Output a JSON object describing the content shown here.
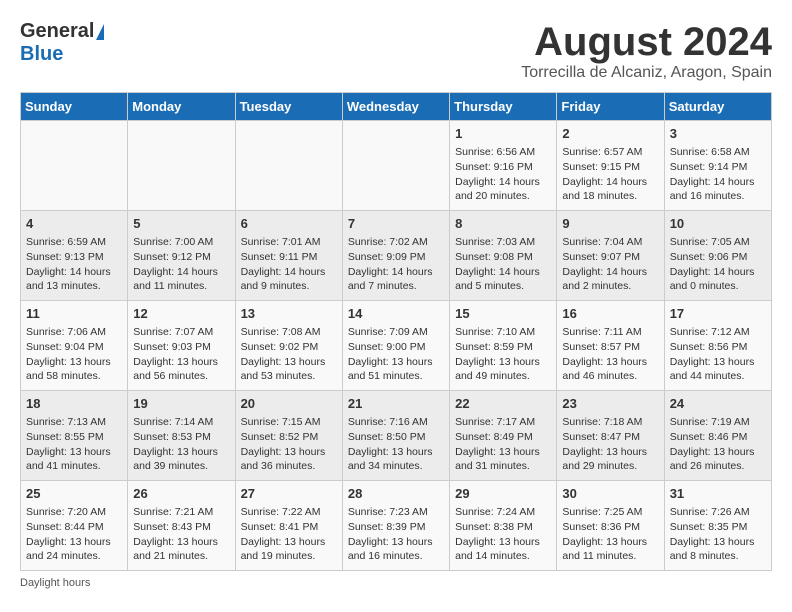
{
  "header": {
    "logo_general": "General",
    "logo_blue": "Blue",
    "month_year": "August 2024",
    "location": "Torrecilla de Alcaniz, Aragon, Spain"
  },
  "days_of_week": [
    "Sunday",
    "Monday",
    "Tuesday",
    "Wednesday",
    "Thursday",
    "Friday",
    "Saturday"
  ],
  "weeks": [
    {
      "days": [
        {
          "num": "",
          "info": ""
        },
        {
          "num": "",
          "info": ""
        },
        {
          "num": "",
          "info": ""
        },
        {
          "num": "",
          "info": ""
        },
        {
          "num": "1",
          "info": "Sunrise: 6:56 AM\nSunset: 9:16 PM\nDaylight: 14 hours and 20 minutes."
        },
        {
          "num": "2",
          "info": "Sunrise: 6:57 AM\nSunset: 9:15 PM\nDaylight: 14 hours and 18 minutes."
        },
        {
          "num": "3",
          "info": "Sunrise: 6:58 AM\nSunset: 9:14 PM\nDaylight: 14 hours and 16 minutes."
        }
      ]
    },
    {
      "days": [
        {
          "num": "4",
          "info": "Sunrise: 6:59 AM\nSunset: 9:13 PM\nDaylight: 14 hours and 13 minutes."
        },
        {
          "num": "5",
          "info": "Sunrise: 7:00 AM\nSunset: 9:12 PM\nDaylight: 14 hours and 11 minutes."
        },
        {
          "num": "6",
          "info": "Sunrise: 7:01 AM\nSunset: 9:11 PM\nDaylight: 14 hours and 9 minutes."
        },
        {
          "num": "7",
          "info": "Sunrise: 7:02 AM\nSunset: 9:09 PM\nDaylight: 14 hours and 7 minutes."
        },
        {
          "num": "8",
          "info": "Sunrise: 7:03 AM\nSunset: 9:08 PM\nDaylight: 14 hours and 5 minutes."
        },
        {
          "num": "9",
          "info": "Sunrise: 7:04 AM\nSunset: 9:07 PM\nDaylight: 14 hours and 2 minutes."
        },
        {
          "num": "10",
          "info": "Sunrise: 7:05 AM\nSunset: 9:06 PM\nDaylight: 14 hours and 0 minutes."
        }
      ]
    },
    {
      "days": [
        {
          "num": "11",
          "info": "Sunrise: 7:06 AM\nSunset: 9:04 PM\nDaylight: 13 hours and 58 minutes."
        },
        {
          "num": "12",
          "info": "Sunrise: 7:07 AM\nSunset: 9:03 PM\nDaylight: 13 hours and 56 minutes."
        },
        {
          "num": "13",
          "info": "Sunrise: 7:08 AM\nSunset: 9:02 PM\nDaylight: 13 hours and 53 minutes."
        },
        {
          "num": "14",
          "info": "Sunrise: 7:09 AM\nSunset: 9:00 PM\nDaylight: 13 hours and 51 minutes."
        },
        {
          "num": "15",
          "info": "Sunrise: 7:10 AM\nSunset: 8:59 PM\nDaylight: 13 hours and 49 minutes."
        },
        {
          "num": "16",
          "info": "Sunrise: 7:11 AM\nSunset: 8:57 PM\nDaylight: 13 hours and 46 minutes."
        },
        {
          "num": "17",
          "info": "Sunrise: 7:12 AM\nSunset: 8:56 PM\nDaylight: 13 hours and 44 minutes."
        }
      ]
    },
    {
      "days": [
        {
          "num": "18",
          "info": "Sunrise: 7:13 AM\nSunset: 8:55 PM\nDaylight: 13 hours and 41 minutes."
        },
        {
          "num": "19",
          "info": "Sunrise: 7:14 AM\nSunset: 8:53 PM\nDaylight: 13 hours and 39 minutes."
        },
        {
          "num": "20",
          "info": "Sunrise: 7:15 AM\nSunset: 8:52 PM\nDaylight: 13 hours and 36 minutes."
        },
        {
          "num": "21",
          "info": "Sunrise: 7:16 AM\nSunset: 8:50 PM\nDaylight: 13 hours and 34 minutes."
        },
        {
          "num": "22",
          "info": "Sunrise: 7:17 AM\nSunset: 8:49 PM\nDaylight: 13 hours and 31 minutes."
        },
        {
          "num": "23",
          "info": "Sunrise: 7:18 AM\nSunset: 8:47 PM\nDaylight: 13 hours and 29 minutes."
        },
        {
          "num": "24",
          "info": "Sunrise: 7:19 AM\nSunset: 8:46 PM\nDaylight: 13 hours and 26 minutes."
        }
      ]
    },
    {
      "days": [
        {
          "num": "25",
          "info": "Sunrise: 7:20 AM\nSunset: 8:44 PM\nDaylight: 13 hours and 24 minutes."
        },
        {
          "num": "26",
          "info": "Sunrise: 7:21 AM\nSunset: 8:43 PM\nDaylight: 13 hours and 21 minutes."
        },
        {
          "num": "27",
          "info": "Sunrise: 7:22 AM\nSunset: 8:41 PM\nDaylight: 13 hours and 19 minutes."
        },
        {
          "num": "28",
          "info": "Sunrise: 7:23 AM\nSunset: 8:39 PM\nDaylight: 13 hours and 16 minutes."
        },
        {
          "num": "29",
          "info": "Sunrise: 7:24 AM\nSunset: 8:38 PM\nDaylight: 13 hours and 14 minutes."
        },
        {
          "num": "30",
          "info": "Sunrise: 7:25 AM\nSunset: 8:36 PM\nDaylight: 13 hours and 11 minutes."
        },
        {
          "num": "31",
          "info": "Sunrise: 7:26 AM\nSunset: 8:35 PM\nDaylight: 13 hours and 8 minutes."
        }
      ]
    }
  ],
  "footer": {
    "daylight_label": "Daylight hours"
  }
}
